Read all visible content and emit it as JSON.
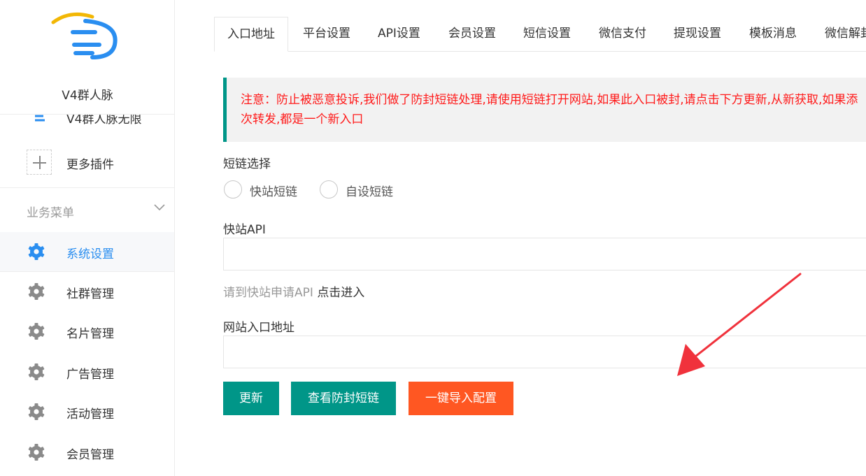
{
  "sidebar": {
    "brand": "V4群人脉",
    "plugin_partial_label": "V4群人脉无限",
    "more_plugins_label": "更多插件",
    "menu_title": "业务菜单",
    "menu_items": [
      {
        "label": "系统设置",
        "active": true
      },
      {
        "label": "社群管理",
        "active": false
      },
      {
        "label": "名片管理",
        "active": false
      },
      {
        "label": "广告管理",
        "active": false
      },
      {
        "label": "活动管理",
        "active": false
      },
      {
        "label": "会员管理",
        "active": false
      }
    ],
    "active_color": "#2a8ef0",
    "gear_color": "#8a8a8a"
  },
  "tabs": [
    "入口地址",
    "平台设置",
    "API设置",
    "会员设置",
    "短信设置",
    "微信支付",
    "提现设置",
    "模板消息",
    "微信解封"
  ],
  "notice": {
    "line1": "注意：防止被恶意投诉,我们做了防封短链处理,请使用短链打开网站,如果此入口被封,请点击下方更新,从新获取,如果添",
    "line2": "次转发,都是一个新入口"
  },
  "form": {
    "shortlink_label": "短链选择",
    "radio_options": [
      "快站短链",
      "自设短链"
    ],
    "kuaizhan_api_label": "快站API",
    "kuaizhan_api_value": "",
    "help_muted": "请到快站申请API",
    "help_link": "点击进入",
    "site_entry_label": "网站入口地址",
    "site_entry_value": ""
  },
  "buttons": {
    "update": "更新",
    "view_shortlink": "查看防封短链",
    "import_config": "一键导入配置"
  },
  "colors": {
    "teal": "#009688",
    "orange": "#ff5722",
    "notice_text": "#ff1a1a",
    "annotation_arrow": "#f0323c"
  }
}
